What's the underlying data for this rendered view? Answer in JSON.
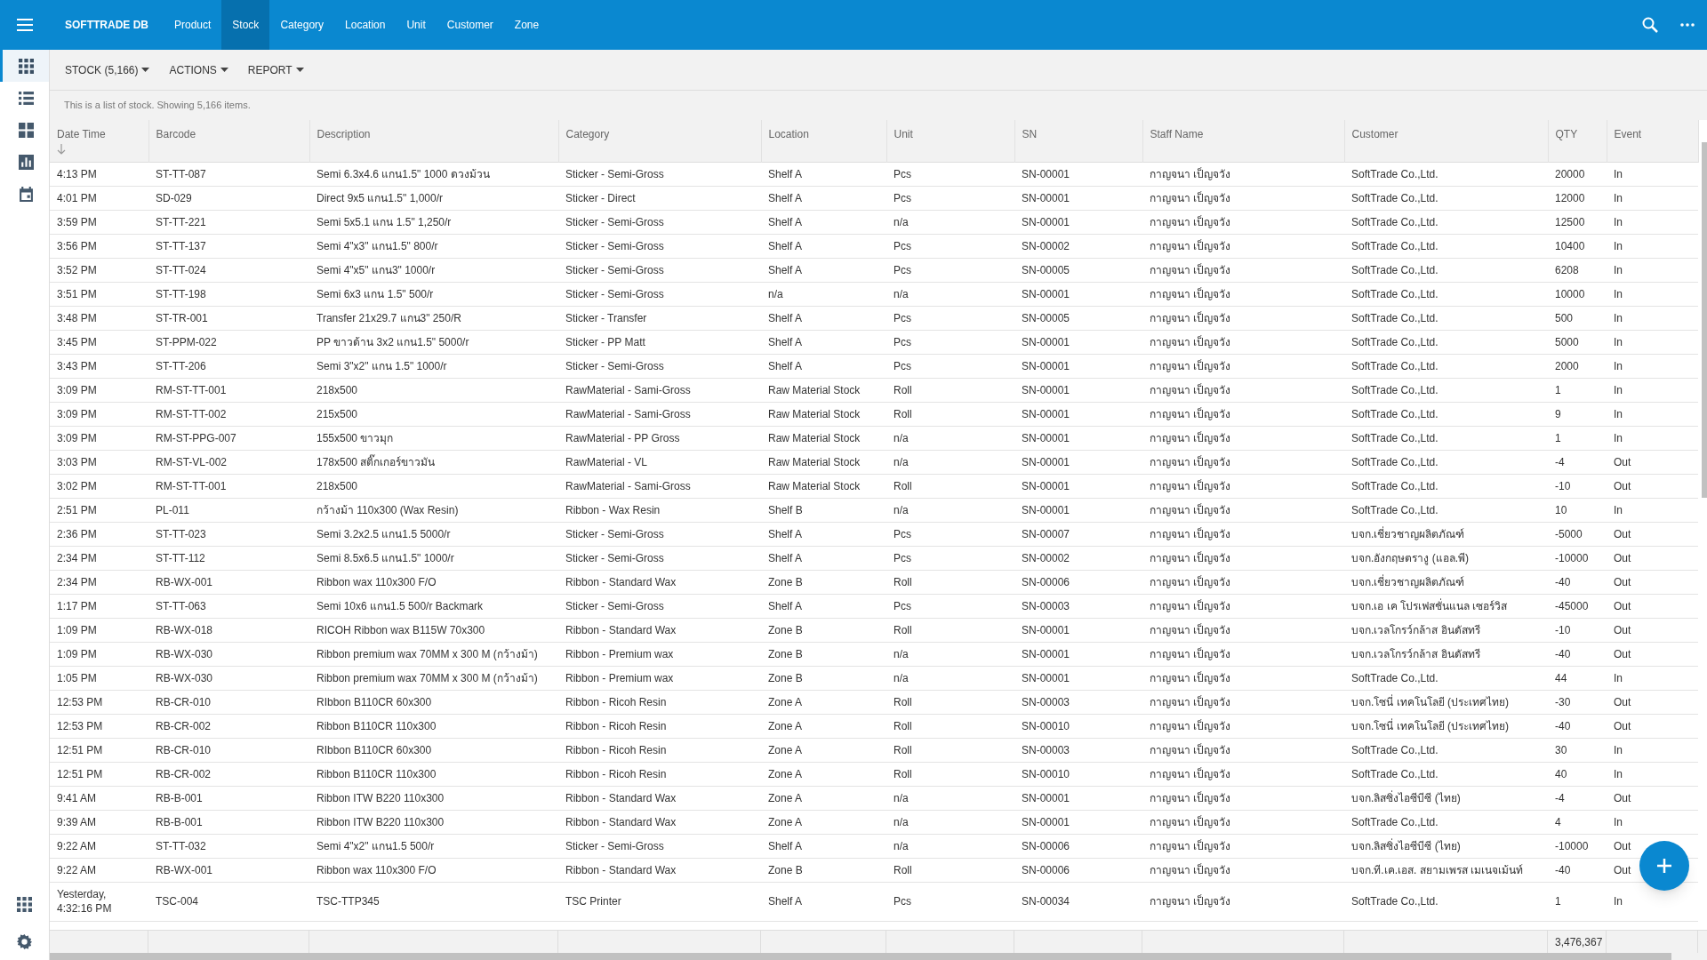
{
  "app": {
    "title": "SOFTTRADE DB"
  },
  "nav": [
    {
      "label": "Product",
      "selected": false
    },
    {
      "label": "Stock",
      "selected": true
    },
    {
      "label": "Category",
      "selected": false
    },
    {
      "label": "Location",
      "selected": false
    },
    {
      "label": "Unit",
      "selected": false
    },
    {
      "label": "Customer",
      "selected": false
    },
    {
      "label": "Zone",
      "selected": false
    }
  ],
  "sidebar": {
    "items": [
      {
        "kind": "grid",
        "selected": true
      },
      {
        "kind": "list",
        "selected": false
      },
      {
        "kind": "tiles",
        "selected": false
      },
      {
        "kind": "chart",
        "selected": false
      },
      {
        "kind": "calendar",
        "selected": false
      }
    ],
    "bottom": [
      {
        "kind": "apps"
      },
      {
        "kind": "settings"
      }
    ]
  },
  "toolbar": [
    {
      "label": "STOCK (5,166)"
    },
    {
      "label": "ACTIONS"
    },
    {
      "label": "REPORT"
    }
  ],
  "info": "This is a list of stock. Showing 5,166 items.",
  "table": {
    "columns": [
      {
        "label": "Date Time",
        "sorted": true
      },
      {
        "label": "Barcode",
        "sorted": false
      },
      {
        "label": "Description",
        "sorted": false
      },
      {
        "label": "Category",
        "sorted": false
      },
      {
        "label": "Location",
        "sorted": false
      },
      {
        "label": "Unit",
        "sorted": false
      },
      {
        "label": "SN",
        "sorted": false
      },
      {
        "label": "Staff Name",
        "sorted": false
      },
      {
        "label": "Customer",
        "sorted": false
      },
      {
        "label": "QTY",
        "sorted": false
      },
      {
        "label": "Event",
        "sorted": false
      }
    ],
    "rows": [
      [
        "4:13 PM",
        "ST-TT-087",
        "Semi 6.3x4.6 แกน1.5\" 1000 ดวงม้วน",
        "Sticker - Semi-Gross",
        "Shelf A",
        "Pcs",
        "SN-00001",
        "กาญจนา เป็ญจวัง",
        "SoftTrade Co.,Ltd.",
        "20000",
        "In"
      ],
      [
        "4:01 PM",
        "SD-029",
        "Direct 9x5 แกน1.5\" 1,000/r",
        "Sticker - Direct",
        "Shelf A",
        "Pcs",
        "SN-00001",
        "กาญจนา เป็ญจวัง",
        "SoftTrade Co.,Ltd.",
        "12000",
        "In"
      ],
      [
        "3:59 PM",
        "ST-TT-221",
        "Semi 5x5.1 แกน 1.5\" 1,250/r",
        "Sticker - Semi-Gross",
        "Shelf A",
        "n/a",
        "SN-00001",
        "กาญจนา เป็ญจวัง",
        "SoftTrade Co.,Ltd.",
        "12500",
        "In"
      ],
      [
        "3:56 PM",
        "ST-TT-137",
        "Semi 4\"x3\" แกน1.5\" 800/r",
        "Sticker - Semi-Gross",
        "Shelf A",
        "Pcs",
        "SN-00002",
        "กาญจนา เป็ญจวัง",
        "SoftTrade Co.,Ltd.",
        "10400",
        "In"
      ],
      [
        "3:52 PM",
        "ST-TT-024",
        "Semi 4\"x5\" แกน3\" 1000/r",
        "Sticker - Semi-Gross",
        "Shelf A",
        "Pcs",
        "SN-00005",
        "กาญจนา เป็ญจวัง",
        "SoftTrade Co.,Ltd.",
        "6208",
        "In"
      ],
      [
        "3:51 PM",
        "ST-TT-198",
        "Semi 6x3 แกน 1.5\" 500/r",
        "Sticker - Semi-Gross",
        "n/a",
        "n/a",
        "SN-00001",
        "กาญจนา เป็ญจวัง",
        "SoftTrade Co.,Ltd.",
        "10000",
        "In"
      ],
      [
        "3:48 PM",
        "ST-TR-001",
        "Transfer 21x29.7 แกน3\" 250/R",
        "Sticker - Transfer",
        "Shelf A",
        "Pcs",
        "SN-00005",
        "กาญจนา เป็ญจวัง",
        "SoftTrade Co.,Ltd.",
        "500",
        "In"
      ],
      [
        "3:45 PM",
        "ST-PPM-022",
        "PP ขาวด้าน 3x2 แกน1.5\" 5000/r",
        "Sticker - PP Matt",
        "Shelf A",
        "Pcs",
        "SN-00001",
        "กาญจนา เป็ญจวัง",
        "SoftTrade Co.,Ltd.",
        "5000",
        "In"
      ],
      [
        "3:43 PM",
        "ST-TT-206",
        "Semi 3\"x2\" แกน 1.5\" 1000/r",
        "Sticker - Semi-Gross",
        "Shelf A",
        "Pcs",
        "SN-00001",
        "กาญจนา เป็ญจวัง",
        "SoftTrade Co.,Ltd.",
        "2000",
        "In"
      ],
      [
        "3:09 PM",
        "RM-ST-TT-001",
        "218x500",
        "RawMaterial - Sami-Gross",
        "Raw Material Stock",
        "Roll",
        "SN-00001",
        "กาญจนา เป็ญจวัง",
        "SoftTrade Co.,Ltd.",
        "1",
        "In"
      ],
      [
        "3:09 PM",
        "RM-ST-TT-002",
        "215x500",
        "RawMaterial - Sami-Gross",
        "Raw Material Stock",
        "Roll",
        "SN-00001",
        "กาญจนา เป็ญจวัง",
        "SoftTrade Co.,Ltd.",
        "9",
        "In"
      ],
      [
        "3:09 PM",
        "RM-ST-PPG-007",
        "155x500 ขาวมุก",
        "RawMaterial - PP Gross",
        "Raw Material Stock",
        "n/a",
        "SN-00001",
        "กาญจนา เป็ญจวัง",
        "SoftTrade Co.,Ltd.",
        "1",
        "In"
      ],
      [
        "3:03 PM",
        "RM-ST-VL-002",
        "178x500 สติ๊กเกอร์ขาวมัน",
        "RawMaterial - VL",
        "Raw Material Stock",
        "n/a",
        "SN-00001",
        "กาญจนา เป็ญจวัง",
        "SoftTrade Co.,Ltd.",
        "-4",
        "Out"
      ],
      [
        "3:02 PM",
        "RM-ST-TT-001",
        "218x500",
        "RawMaterial - Sami-Gross",
        "Raw Material Stock",
        "Roll",
        "SN-00001",
        "กาญจนา เป็ญจวัง",
        "SoftTrade Co.,Ltd.",
        "-10",
        "Out"
      ],
      [
        "2:51 PM",
        "PL-011",
        "กว้างม้า 110x300 (Wax Resin)",
        "Ribbon - Wax Resin",
        "Shelf B",
        "n/a",
        "SN-00001",
        "กาญจนา เป็ญจวัง",
        "SoftTrade Co.,Ltd.",
        "10",
        "In"
      ],
      [
        "2:36 PM",
        "ST-TT-023",
        "Semi 3.2x2.5 แกน1.5 5000/r",
        "Sticker - Semi-Gross",
        "Shelf A",
        "Pcs",
        "SN-00007",
        "กาญจนา เป็ญจวัง",
        "บจก.เชี่ยวชาญผลิตภัณฑ์",
        "-5000",
        "Out"
      ],
      [
        "2:34 PM",
        "ST-TT-112",
        "Semi 8.5x6.5 แกน1.5\" 1000/r",
        "Sticker - Semi-Gross",
        "Shelf A",
        "Pcs",
        "SN-00002",
        "กาญจนา เป็ญจวัง",
        "บจก.อังกฤษตรางู (แอล.พี)",
        "-10000",
        "Out"
      ],
      [
        "2:34 PM",
        "RB-WX-001",
        "Ribbon wax 110x300 F/O",
        "Ribbon - Standard Wax",
        "Zone B",
        "Roll",
        "SN-00006",
        "กาญจนา เป็ญจวัง",
        "บจก.เชี่ยวชาญผลิตภัณฑ์",
        "-40",
        "Out"
      ],
      [
        "1:17 PM",
        "ST-TT-063",
        "Semi 10x6 แกน1.5 500/r Backmark",
        "Sticker - Semi-Gross",
        "Shelf A",
        "Pcs",
        "SN-00003",
        "กาญจนา เป็ญจวัง",
        "บจก.เอ เค โปรเฟสชั่นแนล เซอร์วิส",
        "-45000",
        "Out"
      ],
      [
        "1:09 PM",
        "RB-WX-018",
        "RICOH Ribbon wax B115W 70x300",
        "Ribbon - Standard Wax",
        "Zone B",
        "Roll",
        "SN-00001",
        "กาญจนา เป็ญจวัง",
        "บจก.เวลโกรว์กล้าส อินดัสทรี",
        "-10",
        "Out"
      ],
      [
        "1:09 PM",
        "RB-WX-030",
        "Ribbon premium wax 70MM x 300 M (กว้างม้า)",
        "Ribbon - Premium wax",
        "Zone B",
        "n/a",
        "SN-00001",
        "กาญจนา เป็ญจวัง",
        "บจก.เวลโกรว์กล้าส อินดัสทรี",
        "-40",
        "Out"
      ],
      [
        "1:05 PM",
        "RB-WX-030",
        "Ribbon premium wax 70MM x 300 M (กว้างม้า)",
        "Ribbon - Premium wax",
        "Zone B",
        "n/a",
        "SN-00001",
        "กาญจนา เป็ญจวัง",
        "SoftTrade Co.,Ltd.",
        "44",
        "In"
      ],
      [
        "12:53 PM",
        "RB-CR-010",
        "RIbbon B110CR 60x300",
        "Ribbon - Ricoh Resin",
        "Zone A",
        "Roll",
        "SN-00003",
        "กาญจนา เป็ญจวัง",
        "บจก.โซนี่ เทคโนโลยี (ประเทศไทย)",
        "-30",
        "Out"
      ],
      [
        "12:53 PM",
        "RB-CR-002",
        "Ribbon B110CR 110x300",
        "Ribbon - Ricoh Resin",
        "Zone A",
        "Roll",
        "SN-00010",
        "กาญจนา เป็ญจวัง",
        "บจก.โซนี่ เทคโนโลยี (ประเทศไทย)",
        "-40",
        "Out"
      ],
      [
        "12:51 PM",
        "RB-CR-010",
        "RIbbon B110CR 60x300",
        "Ribbon - Ricoh Resin",
        "Zone A",
        "Roll",
        "SN-00003",
        "กาญจนา เป็ญจวัง",
        "SoftTrade Co.,Ltd.",
        "30",
        "In"
      ],
      [
        "12:51 PM",
        "RB-CR-002",
        "Ribbon B110CR 110x300",
        "Ribbon - Ricoh Resin",
        "Zone A",
        "Roll",
        "SN-00010",
        "กาญจนา เป็ญจวัง",
        "SoftTrade Co.,Ltd.",
        "40",
        "In"
      ],
      [
        "9:41 AM",
        "RB-B-001",
        "Ribbon ITW B220 110x300",
        "Ribbon - Standard Wax",
        "Zone A",
        "n/a",
        "SN-00001",
        "กาญจนา เป็ญจวัง",
        "บจก.ลิสซิ่งไอซีบีซี (ไทย)",
        "-4",
        "Out"
      ],
      [
        "9:39 AM",
        "RB-B-001",
        "Ribbon ITW B220 110x300",
        "Ribbon - Standard Wax",
        "Zone A",
        "n/a",
        "SN-00001",
        "กาญจนา เป็ญจวัง",
        "SoftTrade Co.,Ltd.",
        "4",
        "In"
      ],
      [
        "9:22 AM",
        "ST-TT-032",
        "Semi 4\"x2\" แกน1.5 500/r",
        "Sticker - Semi-Gross",
        "Shelf A",
        "n/a",
        "SN-00006",
        "กาญจนา เป็ญจวัง",
        "บจก.ลิสซิ่งไอซีบีซี (ไทย)",
        "-10000",
        "Out"
      ],
      [
        "9:22 AM",
        "RB-WX-001",
        "Ribbon wax 110x300 F/O",
        "Ribbon - Standard Wax",
        "Zone B",
        "Roll",
        "SN-00006",
        "กาญจนา เป็ญจวัง",
        "บจก.ที.เค.เอส. สยามเพรส เมเนจเม้นท์",
        "-40",
        "Out"
      ],
      [
        "Yesterday,\n4:32:16 PM",
        "TSC-004",
        "TSC-TTP345",
        "TSC Printer",
        "Shelf A",
        "Pcs",
        "SN-00034",
        "กาญจนา เป็ญจวัง",
        "SoftTrade Co.,Ltd.",
        "1",
        "In"
      ]
    ],
    "footer": {
      "qty_total": "3,476,367"
    }
  }
}
